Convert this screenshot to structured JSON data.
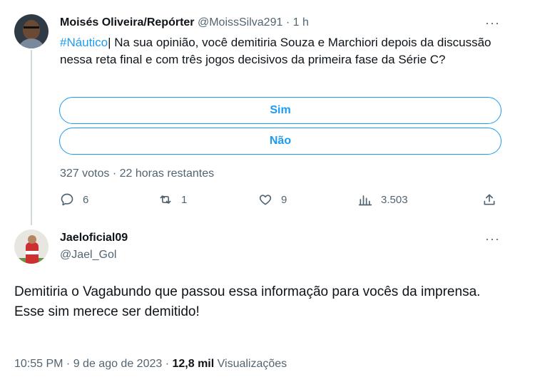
{
  "tweet1": {
    "author_name": "Moisés Oliveira/Repórter",
    "author_handle": "@MoissSilva291",
    "separator": " · ",
    "time_ago": "1 h",
    "hashtag": "#Náutico",
    "text_rest": "| Na sua opinião, você demitiria Souza e Marchiori depois da discussão nessa reta final e com três jogos decisivos da primeira fase da Série C?",
    "more_label": "···",
    "poll": {
      "options": [
        "Sim",
        "Não"
      ],
      "votes": "327 votos",
      "remaining": " · 22 horas restantes"
    },
    "actions": {
      "replies": "6",
      "retweets": "1",
      "likes": "9",
      "views": "3.503"
    }
  },
  "tweet2": {
    "author_name": "Jaeloficial09",
    "author_handle": "@Jael_Gol",
    "more_label": "···",
    "text_line1": "Demitiria o Vagabundo que passou essa informação para vocês da imprensa.",
    "text_line2": "Esse sim merece ser demitido!",
    "time": "10:55 PM",
    "date": "9 de ago de 2023",
    "sep": " · ",
    "views_count": "12,8 mil",
    "views_label": "Visualizações"
  },
  "colors": {
    "accent": "#1d9bf0",
    "secondary_text": "#536471",
    "primary_text": "#0f1419",
    "thread_line": "#cfd9de"
  }
}
